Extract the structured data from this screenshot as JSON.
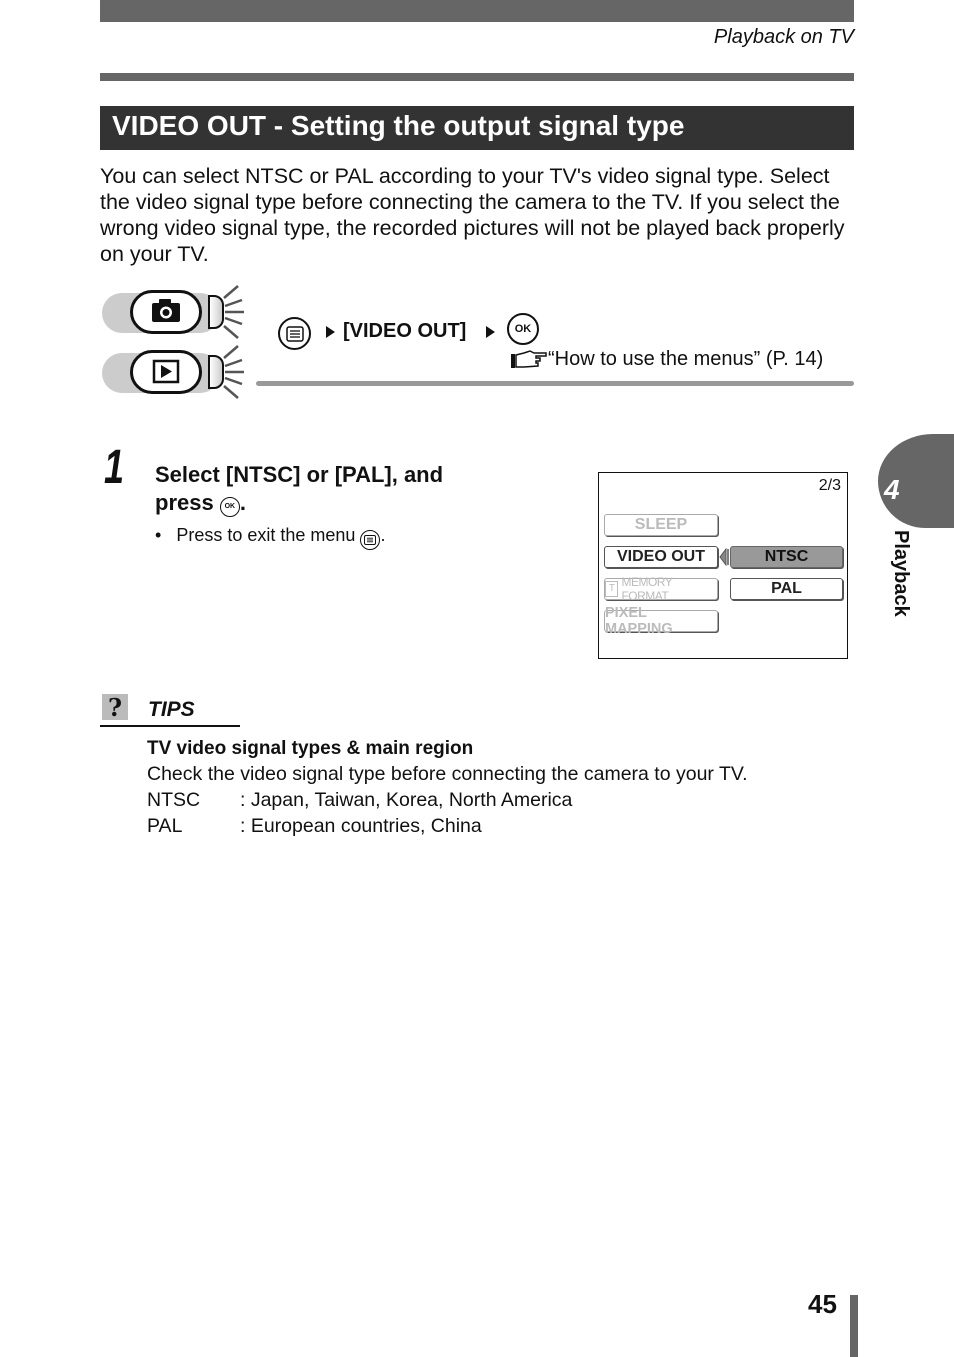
{
  "header": {
    "running_head": "Playback on TV"
  },
  "section": {
    "title": "VIDEO OUT - Setting the output signal type",
    "intro": "You can select NTSC or PAL according to your TV's video signal type. Select the video signal type before connecting the camera to the TV. If you select the wrong video signal type, the recorded pictures will not be played back properly on your TV."
  },
  "procedure": {
    "modes": [
      {
        "icon": "camera-icon",
        "name": "shooting mode"
      },
      {
        "icon": "play-icon",
        "name": "playback mode"
      }
    ],
    "path_label": "[VIDEO OUT]",
    "ok_label": "OK",
    "reference": "“How to use the menus” (P. 14)"
  },
  "step": {
    "number": "1",
    "title_line1": "Select [NTSC] or [PAL], and",
    "title_line2_prefix": "press",
    "title_line2_suffix": ".",
    "ok_label": "OK",
    "bullet": "•",
    "bullet_text": "Press  to exit the menu",
    "bullet_suffix": "."
  },
  "screen": {
    "page_indicator": "2/3",
    "menu_items": [
      {
        "label": "SLEEP",
        "state": "dim"
      },
      {
        "label": "VIDEO OUT",
        "state": "active"
      },
      {
        "label": "MEMORY FORMAT",
        "state": "dim"
      },
      {
        "label": "PIXEL MAPPING",
        "state": "dim"
      }
    ],
    "options": [
      {
        "label": "NTSC",
        "selected": true
      },
      {
        "label": "PAL",
        "selected": false
      }
    ]
  },
  "tips": {
    "label": "TIPS",
    "heading": "TV video signal types & main region",
    "text": "Check the video signal type before connecting the camera to your TV.",
    "rows": [
      {
        "key": "NTSC",
        "value": ": Japan, Taiwan, Korea, North America"
      },
      {
        "key": "PAL",
        "value": ": European countries, China"
      }
    ]
  },
  "chapter": {
    "number": "4",
    "label": "Playback"
  },
  "footer": {
    "page_number": "45"
  }
}
